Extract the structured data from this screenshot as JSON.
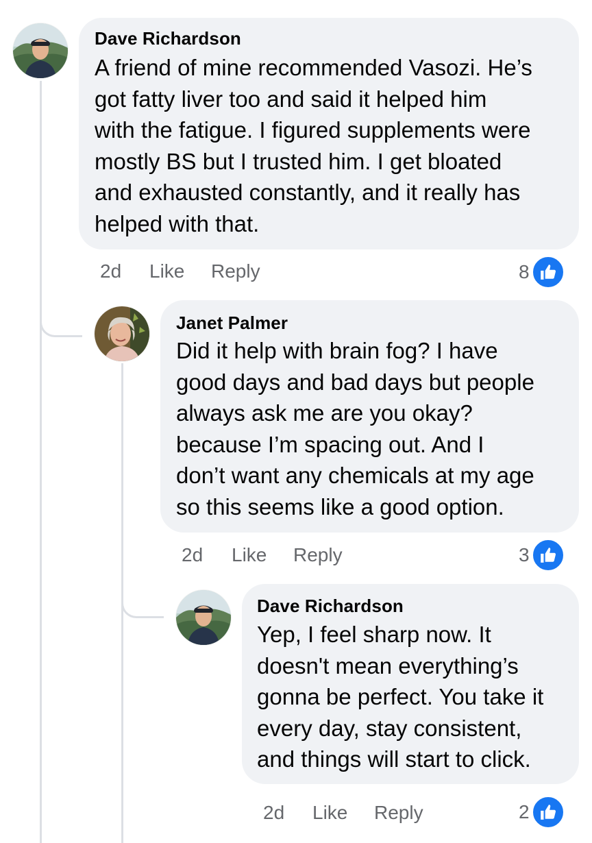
{
  "colors": {
    "bubble": "#f0f2f5",
    "author": "#050505",
    "meta": "#65676b",
    "like_blue": "#1877f2",
    "thread_line": "#dcdfe4"
  },
  "actions": {
    "like_label": "Like",
    "reply_label": "Reply"
  },
  "icons": {
    "reaction": "thumbs-up-icon"
  },
  "comments": [
    {
      "author": "Dave Richardson",
      "text": "A friend of mine recommended Vasozi. He’s\ngot fatty liver too and said it helped him\nwith the fatigue. I figured supplements were\nmostly BS but I trusted him. I get bloated\nand exhausted constantly, and it really has\nhelped with that.",
      "time": "2d",
      "reaction_count": "8"
    },
    {
      "author": "Janet Palmer",
      "text": "Did it help with brain fog? I have\ngood days and bad days but people\nalways ask me are you okay?\nbecause I’m spacing out. And I\ndon’t want any chemicals at my age\nso this seems like a good option.",
      "time": "2d",
      "reaction_count": "3"
    },
    {
      "author": "Dave Richardson",
      "text": "Yep, I feel sharp now. It\ndoesn't mean everything’s\ngonna be perfect. You take it\nevery day, stay consistent,\nand things will start to click.",
      "time": "2d",
      "reaction_count": "2"
    }
  ]
}
